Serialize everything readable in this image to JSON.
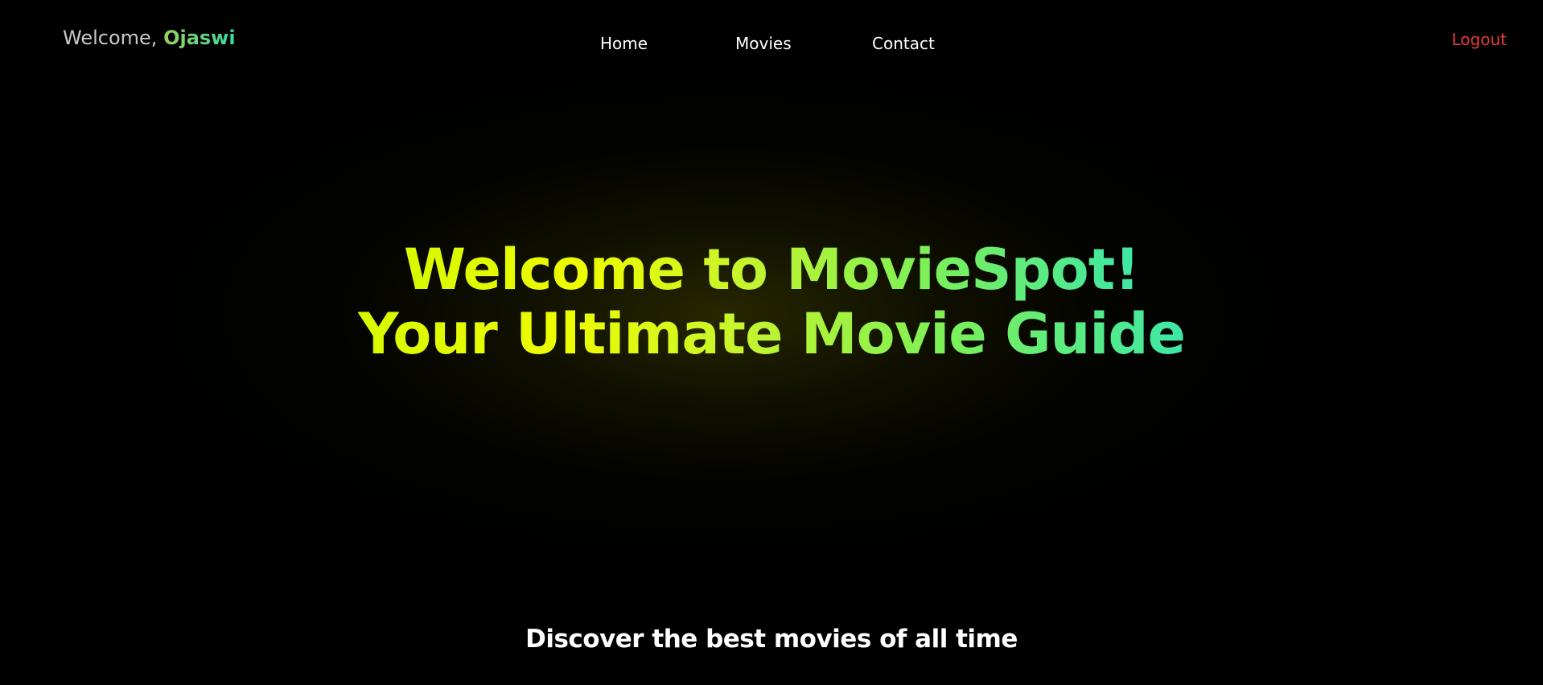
{
  "header": {
    "greeting": "Welcome,",
    "username": "Ojaswi",
    "logout_label": "Logout"
  },
  "nav": {
    "items": [
      {
        "label": "Home"
      },
      {
        "label": "Movies"
      },
      {
        "label": "Contact"
      }
    ]
  },
  "hero": {
    "title_line1": "Welcome to MovieSpot!",
    "title_line2": "Your Ultimate Movie Guide",
    "subtitle": "Discover the best movies of all time"
  },
  "colors": {
    "background": "#000000",
    "logout": "#e23b3b",
    "gradient_start": "#d7f900",
    "gradient_end": "#3de7a6"
  }
}
